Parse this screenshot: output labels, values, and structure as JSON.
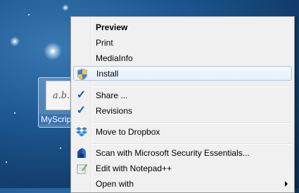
{
  "desktop": {
    "icon_label": "MyScript",
    "doc_preview_text": "a.b."
  },
  "context_menu": {
    "items": [
      {
        "label": "Preview",
        "icon": "none"
      },
      {
        "label": "Print",
        "icon": "none"
      },
      {
        "label": "MediaInfo",
        "icon": "none"
      },
      {
        "label": "Install",
        "icon": "uac-shield-icon",
        "highlighted": true
      },
      {
        "label": "Share ...",
        "icon": "checkmark-icon"
      },
      {
        "label": "Revisions",
        "icon": "checkmark-icon"
      },
      {
        "label": "Move to Dropbox",
        "icon": "dropbox-icon"
      },
      {
        "label": "Scan with Microsoft Security Essentials...",
        "icon": "security-essentials-icon"
      },
      {
        "label": "Edit with Notepad++",
        "icon": "notepad-plus-plus-icon"
      },
      {
        "label": "Open with",
        "icon": "none",
        "has_submenu": true
      }
    ]
  },
  "colors": {
    "menu_background": "#f0f0f0",
    "highlight_border": "#a8c8ea",
    "checkmark": "#1a58b8"
  }
}
